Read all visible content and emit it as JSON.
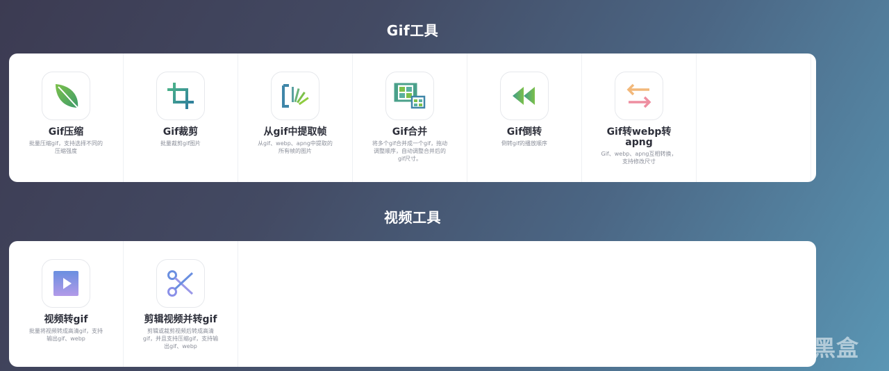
{
  "sections": {
    "gif": {
      "title": "Gif工具",
      "tools": [
        {
          "name": "Gif压缩",
          "desc": "批量压缩gif，支持选择不同的压缩强度",
          "icon": "leaf-icon"
        },
        {
          "name": "Gif裁剪",
          "desc": "批量裁剪gif图片",
          "icon": "crop-icon"
        },
        {
          "name": "从gif中提取帧",
          "desc": "从gif、webp、apng中提取的所有帧的图片",
          "icon": "extract-frames-icon"
        },
        {
          "name": "Gif合并",
          "desc": "将多个gif合并成一个gif，拖动调整顺序，自动调整合并后的gif尺寸。",
          "icon": "film-merge-icon"
        },
        {
          "name": "Gif倒转",
          "desc": "倒转gif的播放顺序",
          "icon": "rewind-icon"
        },
        {
          "name": "Gif转webp转apng",
          "desc": "Gif、webp、apng互相转换，支持修改尺寸",
          "icon": "convert-arrows-icon"
        }
      ]
    },
    "video": {
      "title": "视频工具",
      "tools": [
        {
          "name": "视频转gif",
          "desc": "批量将视频转成高清gif，支持输出gif、webp",
          "icon": "video-play-icon"
        },
        {
          "name": "剪辑视频并转gif",
          "desc": "剪辑或裁剪视频后转成高清gif，并且支持压缩gif，支持输出gif、webp",
          "icon": "scissors-icon"
        }
      ]
    }
  },
  "watermark": {
    "text": "小黑盒"
  }
}
